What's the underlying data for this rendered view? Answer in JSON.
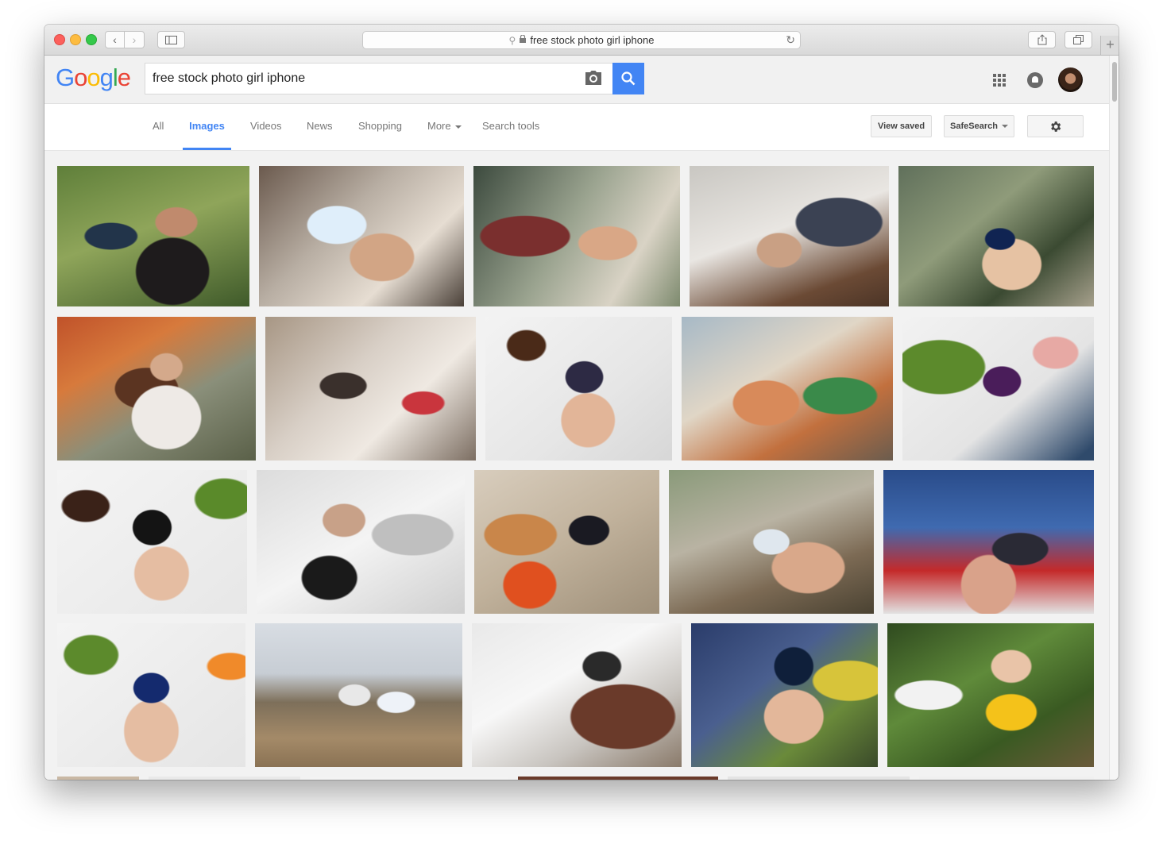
{
  "browser": {
    "url": "free stock photo girl iphone"
  },
  "header": {
    "logo_letters": [
      "G",
      "o",
      "o",
      "g",
      "l",
      "e"
    ],
    "search_value": "free stock photo girl iphone"
  },
  "tabs": [
    {
      "label": "All",
      "active": false
    },
    {
      "label": "Images",
      "active": true
    },
    {
      "label": "Videos",
      "active": false
    },
    {
      "label": "News",
      "active": false
    },
    {
      "label": "Shopping",
      "active": false
    },
    {
      "label": "More",
      "active": false
    },
    {
      "label": "Search tools",
      "active": false
    }
  ],
  "tools": {
    "view_saved": "View saved",
    "safesearch": "SafeSearch"
  },
  "colors": {
    "accent": "#4285f4"
  }
}
